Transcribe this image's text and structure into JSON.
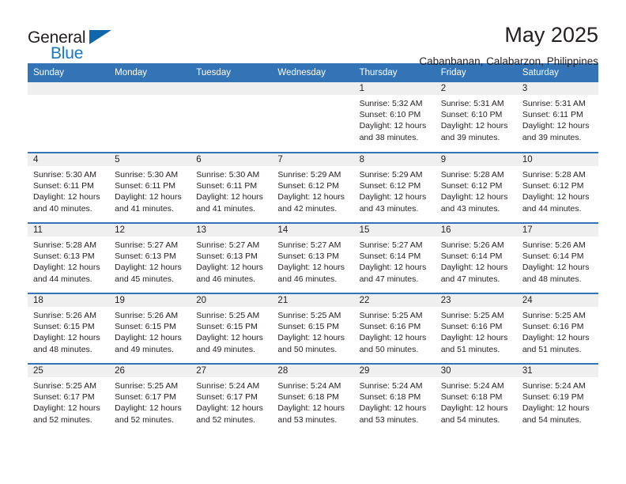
{
  "brand": {
    "name_part1": "General",
    "name_part2": "Blue",
    "accent_color": "#1167ab",
    "logo_icon": "triangle-icon"
  },
  "header": {
    "month_title": "May 2025",
    "location": "Cabanbanan, Calabarzon, Philippines",
    "header_bg": "#3274b6"
  },
  "weekday_headers": [
    "Sunday",
    "Monday",
    "Tuesday",
    "Wednesday",
    "Thursday",
    "Friday",
    "Saturday"
  ],
  "weeks": [
    [
      {
        "day": "",
        "lines": []
      },
      {
        "day": "",
        "lines": []
      },
      {
        "day": "",
        "lines": []
      },
      {
        "day": "",
        "lines": []
      },
      {
        "day": "1",
        "lines": [
          "Sunrise: 5:32 AM",
          "Sunset: 6:10 PM",
          "Daylight: 12 hours",
          "and 38 minutes."
        ]
      },
      {
        "day": "2",
        "lines": [
          "Sunrise: 5:31 AM",
          "Sunset: 6:10 PM",
          "Daylight: 12 hours",
          "and 39 minutes."
        ]
      },
      {
        "day": "3",
        "lines": [
          "Sunrise: 5:31 AM",
          "Sunset: 6:11 PM",
          "Daylight: 12 hours",
          "and 39 minutes."
        ]
      }
    ],
    [
      {
        "day": "4",
        "lines": [
          "Sunrise: 5:30 AM",
          "Sunset: 6:11 PM",
          "Daylight: 12 hours",
          "and 40 minutes."
        ]
      },
      {
        "day": "5",
        "lines": [
          "Sunrise: 5:30 AM",
          "Sunset: 6:11 PM",
          "Daylight: 12 hours",
          "and 41 minutes."
        ]
      },
      {
        "day": "6",
        "lines": [
          "Sunrise: 5:30 AM",
          "Sunset: 6:11 PM",
          "Daylight: 12 hours",
          "and 41 minutes."
        ]
      },
      {
        "day": "7",
        "lines": [
          "Sunrise: 5:29 AM",
          "Sunset: 6:12 PM",
          "Daylight: 12 hours",
          "and 42 minutes."
        ]
      },
      {
        "day": "8",
        "lines": [
          "Sunrise: 5:29 AM",
          "Sunset: 6:12 PM",
          "Daylight: 12 hours",
          "and 43 minutes."
        ]
      },
      {
        "day": "9",
        "lines": [
          "Sunrise: 5:28 AM",
          "Sunset: 6:12 PM",
          "Daylight: 12 hours",
          "and 43 minutes."
        ]
      },
      {
        "day": "10",
        "lines": [
          "Sunrise: 5:28 AM",
          "Sunset: 6:12 PM",
          "Daylight: 12 hours",
          "and 44 minutes."
        ]
      }
    ],
    [
      {
        "day": "11",
        "lines": [
          "Sunrise: 5:28 AM",
          "Sunset: 6:13 PM",
          "Daylight: 12 hours",
          "and 44 minutes."
        ]
      },
      {
        "day": "12",
        "lines": [
          "Sunrise: 5:27 AM",
          "Sunset: 6:13 PM",
          "Daylight: 12 hours",
          "and 45 minutes."
        ]
      },
      {
        "day": "13",
        "lines": [
          "Sunrise: 5:27 AM",
          "Sunset: 6:13 PM",
          "Daylight: 12 hours",
          "and 46 minutes."
        ]
      },
      {
        "day": "14",
        "lines": [
          "Sunrise: 5:27 AM",
          "Sunset: 6:13 PM",
          "Daylight: 12 hours",
          "and 46 minutes."
        ]
      },
      {
        "day": "15",
        "lines": [
          "Sunrise: 5:27 AM",
          "Sunset: 6:14 PM",
          "Daylight: 12 hours",
          "and 47 minutes."
        ]
      },
      {
        "day": "16",
        "lines": [
          "Sunrise: 5:26 AM",
          "Sunset: 6:14 PM",
          "Daylight: 12 hours",
          "and 47 minutes."
        ]
      },
      {
        "day": "17",
        "lines": [
          "Sunrise: 5:26 AM",
          "Sunset: 6:14 PM",
          "Daylight: 12 hours",
          "and 48 minutes."
        ]
      }
    ],
    [
      {
        "day": "18",
        "lines": [
          "Sunrise: 5:26 AM",
          "Sunset: 6:15 PM",
          "Daylight: 12 hours",
          "and 48 minutes."
        ]
      },
      {
        "day": "19",
        "lines": [
          "Sunrise: 5:26 AM",
          "Sunset: 6:15 PM",
          "Daylight: 12 hours",
          "and 49 minutes."
        ]
      },
      {
        "day": "20",
        "lines": [
          "Sunrise: 5:25 AM",
          "Sunset: 6:15 PM",
          "Daylight: 12 hours",
          "and 49 minutes."
        ]
      },
      {
        "day": "21",
        "lines": [
          "Sunrise: 5:25 AM",
          "Sunset: 6:15 PM",
          "Daylight: 12 hours",
          "and 50 minutes."
        ]
      },
      {
        "day": "22",
        "lines": [
          "Sunrise: 5:25 AM",
          "Sunset: 6:16 PM",
          "Daylight: 12 hours",
          "and 50 minutes."
        ]
      },
      {
        "day": "23",
        "lines": [
          "Sunrise: 5:25 AM",
          "Sunset: 6:16 PM",
          "Daylight: 12 hours",
          "and 51 minutes."
        ]
      },
      {
        "day": "24",
        "lines": [
          "Sunrise: 5:25 AM",
          "Sunset: 6:16 PM",
          "Daylight: 12 hours",
          "and 51 minutes."
        ]
      }
    ],
    [
      {
        "day": "25",
        "lines": [
          "Sunrise: 5:25 AM",
          "Sunset: 6:17 PM",
          "Daylight: 12 hours",
          "and 52 minutes."
        ]
      },
      {
        "day": "26",
        "lines": [
          "Sunrise: 5:25 AM",
          "Sunset: 6:17 PM",
          "Daylight: 12 hours",
          "and 52 minutes."
        ]
      },
      {
        "day": "27",
        "lines": [
          "Sunrise: 5:24 AM",
          "Sunset: 6:17 PM",
          "Daylight: 12 hours",
          "and 52 minutes."
        ]
      },
      {
        "day": "28",
        "lines": [
          "Sunrise: 5:24 AM",
          "Sunset: 6:18 PM",
          "Daylight: 12 hours",
          "and 53 minutes."
        ]
      },
      {
        "day": "29",
        "lines": [
          "Sunrise: 5:24 AM",
          "Sunset: 6:18 PM",
          "Daylight: 12 hours",
          "and 53 minutes."
        ]
      },
      {
        "day": "30",
        "lines": [
          "Sunrise: 5:24 AM",
          "Sunset: 6:18 PM",
          "Daylight: 12 hours",
          "and 54 minutes."
        ]
      },
      {
        "day": "31",
        "lines": [
          "Sunrise: 5:24 AM",
          "Sunset: 6:19 PM",
          "Daylight: 12 hours",
          "and 54 minutes."
        ]
      }
    ]
  ]
}
